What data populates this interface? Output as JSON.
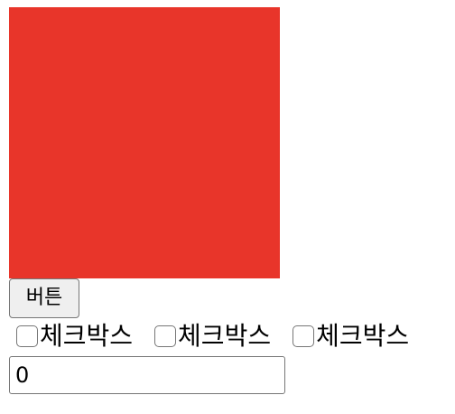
{
  "colors": {
    "box": "#e8352a"
  },
  "button": {
    "label": "버튼"
  },
  "checkboxes": [
    {
      "label": "체크박스",
      "checked": false
    },
    {
      "label": "체크박스",
      "checked": false
    },
    {
      "label": "체크박스",
      "checked": false
    }
  ],
  "input": {
    "value": "0"
  }
}
